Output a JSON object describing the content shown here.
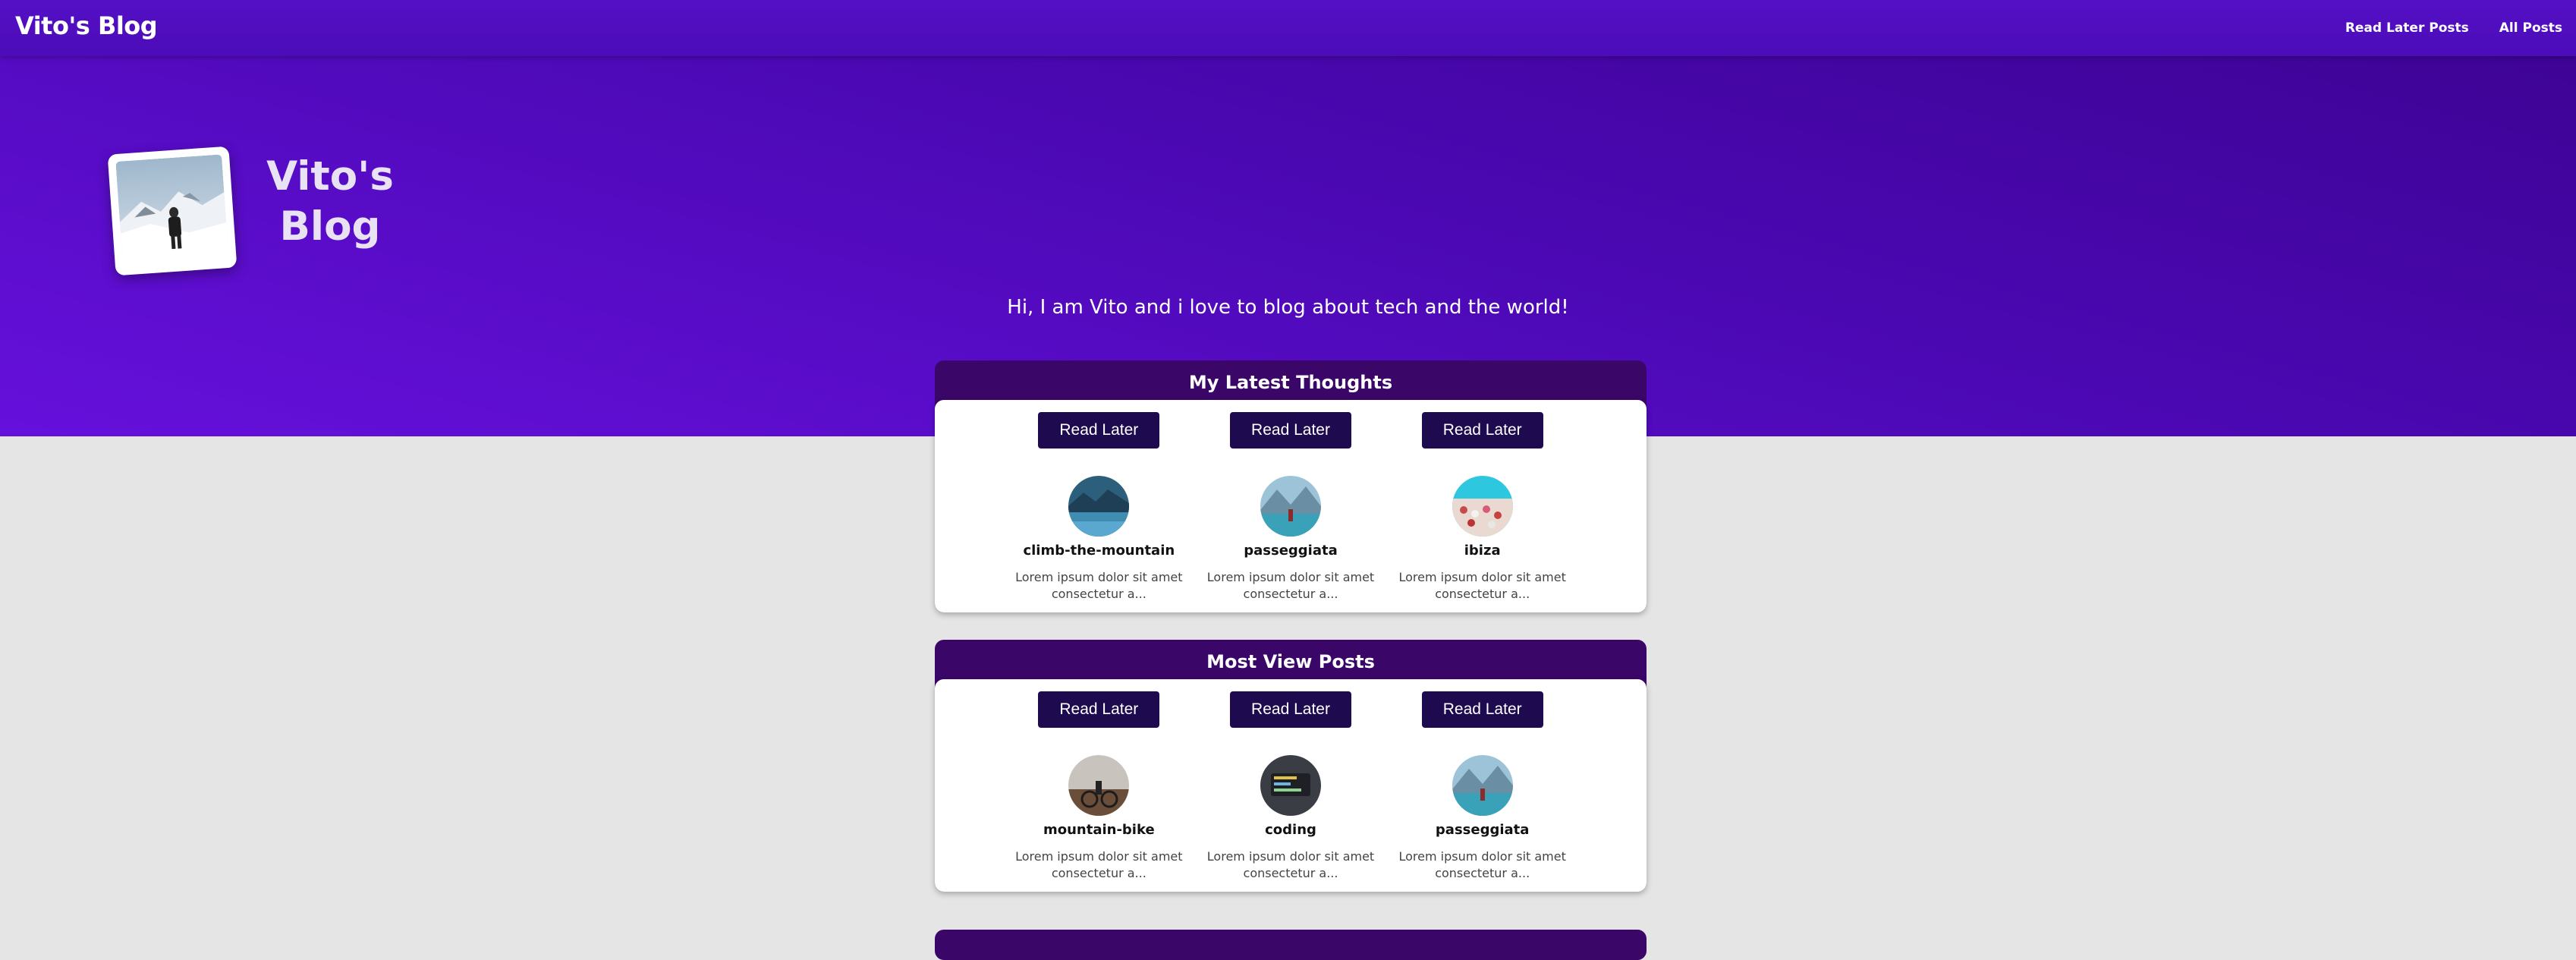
{
  "header": {
    "brand": "Vito's Blog",
    "nav": [
      {
        "label": "Read Later Posts"
      },
      {
        "label": "All Posts"
      }
    ]
  },
  "hero": {
    "title": "Vito's Blog",
    "tagline": "Hi, I am Vito and i love to blog about tech and the world!"
  },
  "sections": [
    {
      "title": "My Latest Thoughts",
      "posts": [
        {
          "button": "Read Later",
          "name": "climb-the-mountain",
          "excerpt": "Lorem ipsum dolor sit amet consectetur a..."
        },
        {
          "button": "Read Later",
          "name": "passeggiata",
          "excerpt": "Lorem ipsum dolor sit amet consectetur a..."
        },
        {
          "button": "Read Later",
          "name": "ibiza",
          "excerpt": "Lorem ipsum dolor sit amet consectetur a..."
        }
      ]
    },
    {
      "title": "Most View Posts",
      "posts": [
        {
          "button": "Read Later",
          "name": "mountain-bike",
          "excerpt": "Lorem ipsum dolor sit amet consectetur a..."
        },
        {
          "button": "Read Later",
          "name": "coding",
          "excerpt": "Lorem ipsum dolor sit amet consectetur a..."
        },
        {
          "button": "Read Later",
          "name": "passeggiata",
          "excerpt": "Lorem ipsum dolor sit amet consectetur a..."
        }
      ]
    }
  ],
  "colors": {
    "accent": "#4a08b2",
    "section_header": "#3a0668",
    "button": "#1e0a4e",
    "page_bg": "#e5e5e5"
  }
}
